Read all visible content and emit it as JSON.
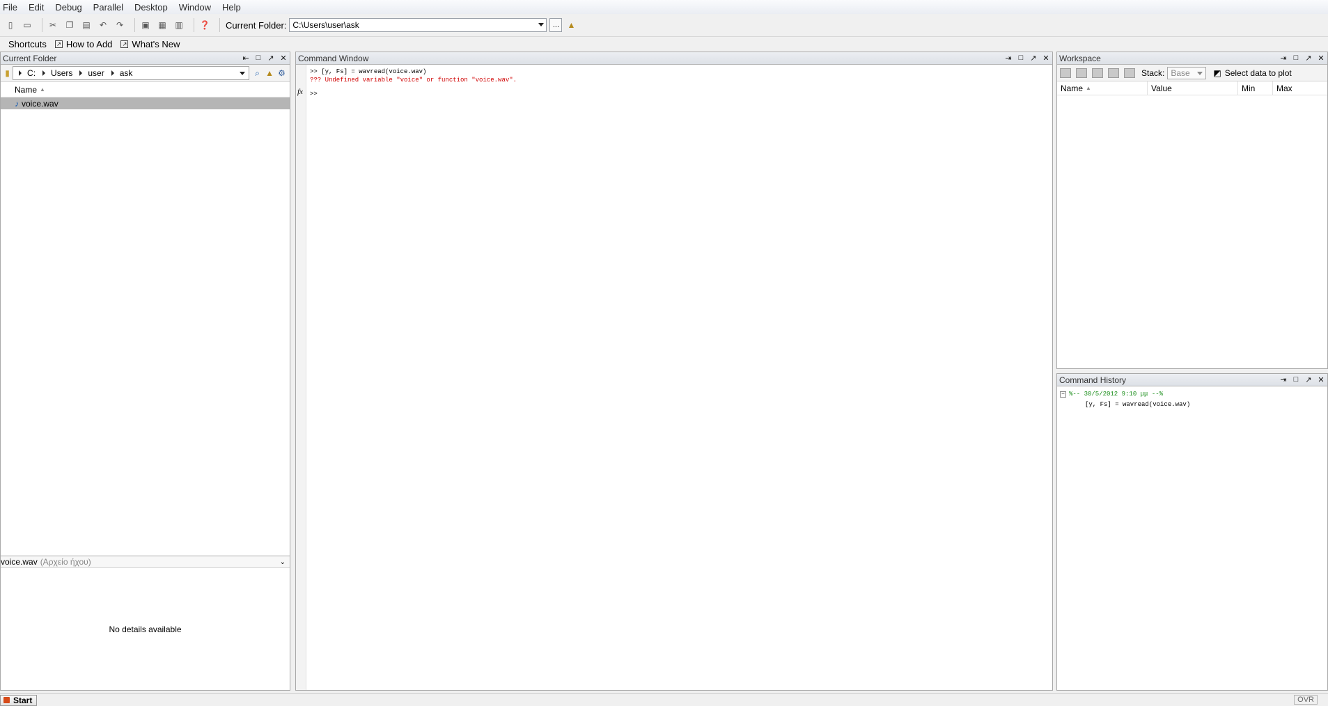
{
  "menu": [
    "File",
    "Edit",
    "Debug",
    "Parallel",
    "Desktop",
    "Window",
    "Help"
  ],
  "toolbar": {
    "current_folder_label": "Current Folder:",
    "current_folder_path": "C:\\Users\\user\\ask",
    "browse_label": "..."
  },
  "shortcuts": {
    "label": "Shortcuts",
    "how_to_add": "How to Add",
    "whats_new": "What's New"
  },
  "current_folder": {
    "title": "Current Folder",
    "path": [
      "C:",
      "Users",
      "user",
      "ask"
    ],
    "column_name": "Name",
    "files": [
      "voice.wav"
    ],
    "details_file": "voice.wav",
    "details_type": "(Αρχείο ήχου)",
    "details_empty": "No details available"
  },
  "command_window": {
    "title": "Command Window",
    "line1": ">> [y, Fs] = wavread(voice.wav)",
    "error": "??? Undefined variable \"voice\" or function \"voice.wav\".",
    "prompt": ">>",
    "fx": "fx"
  },
  "workspace": {
    "title": "Workspace",
    "stack_label": "Stack:",
    "stack_value": "Base",
    "plot_label": "Select data to plot",
    "columns": [
      "Name",
      "Value",
      "Min",
      "Max"
    ]
  },
  "history": {
    "title": "Command History",
    "group": "%-- 30/5/2012 9:10 μμ --%",
    "items": [
      "[y, Fs] = wavread(voice.wav)"
    ]
  },
  "status": {
    "start": "Start",
    "ovr": "OVR"
  }
}
